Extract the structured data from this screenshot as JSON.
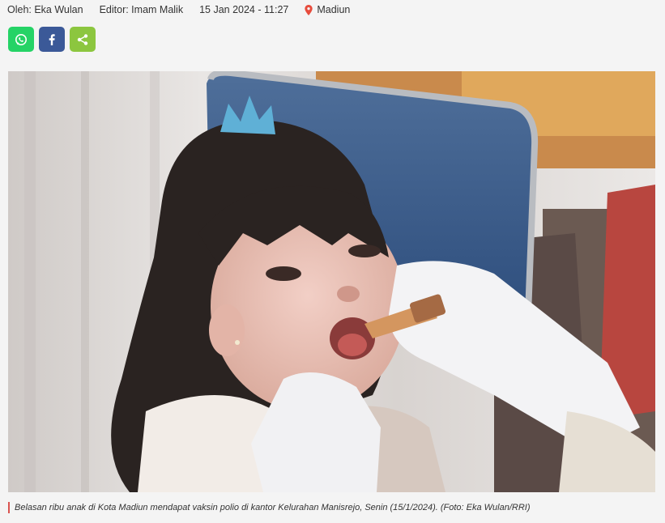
{
  "meta": {
    "author": "Oleh: Eka Wulan",
    "editor": "Editor: Imam Malik",
    "datetime": "15 Jan 2024 - 11:27",
    "location": "Madiun",
    "location_icon": "map-pin-icon",
    "location_icon_color": "#e74c3c"
  },
  "share": {
    "whatsapp_icon": "whatsapp-icon",
    "facebook_icon": "facebook-icon",
    "share_icon": "share-icon",
    "colors": {
      "whatsapp": "#25d366",
      "facebook": "#3b5998",
      "share": "#8cc63f"
    }
  },
  "photo": {
    "alt": ""
  },
  "caption": {
    "text": "Belasan ribu anak di Kota Madiun mendapat vaksin polio di kantor Kelurahan Manisrejo, Senin (15/1/2024). (Foto: Eka Wulan/RRI)",
    "accent_color": "#d9534f"
  }
}
